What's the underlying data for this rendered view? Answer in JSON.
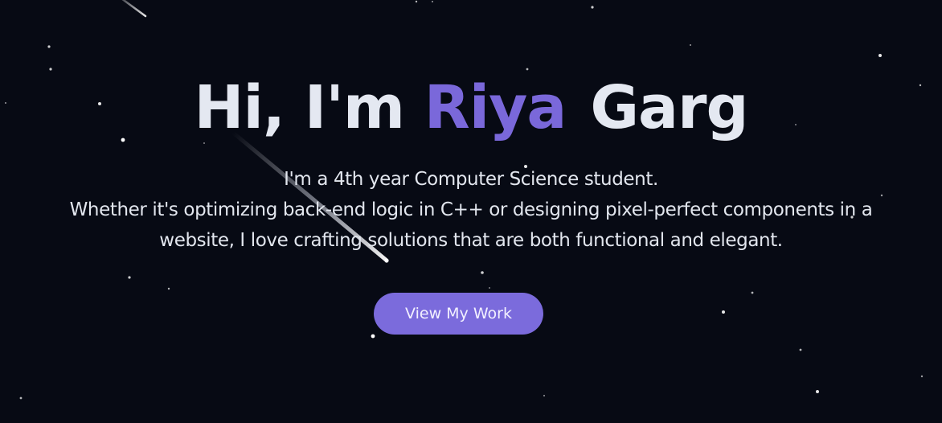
{
  "hero": {
    "greeting": "Hi, I'm",
    "first_name": "Riya",
    "last_name": "Garg",
    "intro_line_1": "I'm a 4th year Computer Science student.",
    "intro_line_2": "Whether it's optimizing back-end logic in C++ or designing pixel-perfect components in a",
    "intro_line_3": "website, I love crafting solutions that are both functional and elegant.",
    "cta_label": "View My Work"
  },
  "colors": {
    "background": "#070a14",
    "accent": "#7b6bdc",
    "text": "#e4e8f1"
  }
}
